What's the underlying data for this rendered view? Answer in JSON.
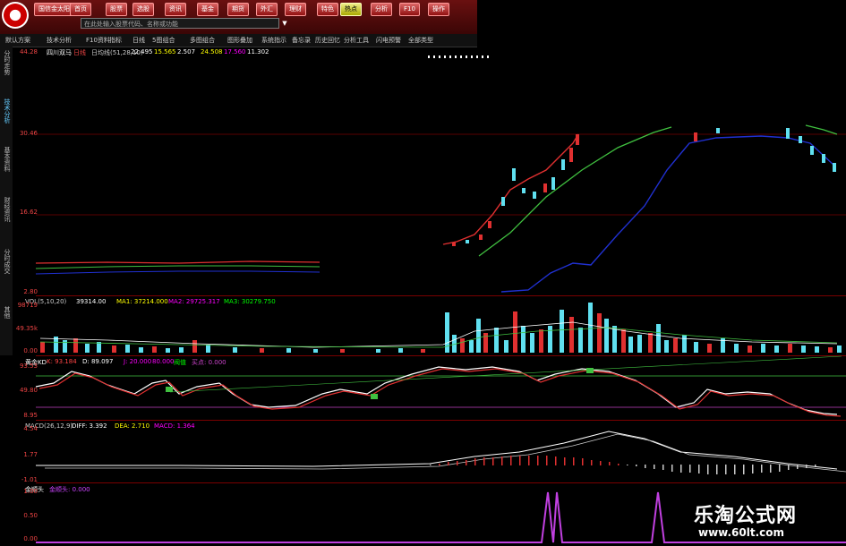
{
  "toolbar": {
    "buttons": [
      "国信金太阳",
      "首页",
      "股票",
      "选股",
      "资讯",
      "基金",
      "期货",
      "外汇",
      "理财",
      "特色",
      "热点",
      "分析",
      "F10",
      "操作"
    ],
    "command_placeholder": "在此处输入股票代码、名称或功能",
    "dropdown_arrow": "▼"
  },
  "menubar": {
    "items": [
      "默认方案",
      "技术分析",
      "F10资料",
      "指标",
      "日线",
      "5图组合",
      "多图组合",
      "图形叠加",
      "系统指示",
      "备忘录",
      "历史回忆",
      "分析工具",
      "闪电预警",
      "全部类型"
    ]
  },
  "sidetabs": {
    "items": [
      "分时走势",
      "技术分析",
      "基本资料",
      "财经资讯",
      "分时成交",
      "其他"
    ],
    "active": 1
  },
  "main_pane": {
    "stock_name": "四川双马",
    "period": "日线",
    "indicator": "日均线(51,28,10)",
    "values": [
      "22.495",
      "15.565",
      "2.507",
      "24.508",
      "17.560",
      "11.302"
    ],
    "y_labels": [
      "44.28",
      "30.46",
      "16.62",
      "2.80"
    ]
  },
  "volume_pane": {
    "header": "VOL(5,10,20)",
    "values": [
      "39314.00",
      "MA1: 37214.000",
      "MA2: 29725.317",
      "MA3: 30279.750"
    ],
    "y_labels": [
      "98719",
      "49.35k",
      "0.00"
    ]
  },
  "kdj_pane": {
    "header": "黄金KD",
    "values": [
      "K: 93.184",
      "D: 89.097",
      "J: 20.000",
      "80.000",
      "阀值",
      "买点: 0.000"
    ],
    "y_labels": [
      "93.53",
      "49.80",
      "8.95"
    ]
  },
  "macd_pane": {
    "header": "MACD(26,12,9)",
    "values": [
      "DIFF: 3.392",
      "DEA: 2.710",
      "MACD: 1.364"
    ],
    "y_labels": [
      "4.54",
      "1.77",
      "-1.01"
    ]
  },
  "signal_pane": {
    "header": "金顺头",
    "values": [
      "金顺头: 0.000"
    ],
    "y_labels": [
      "1.00",
      "0.50",
      "0.00"
    ]
  },
  "watermark": {
    "title": "乐淘公式网",
    "url": "www.60lt.com"
  },
  "colors": {
    "toolbar_bg": "#6a1010",
    "price_red": "#e03030",
    "ma_green": "#40c040",
    "ma_blue": "#2030d0",
    "cyan_bar": "#60e0f0",
    "kdj_k": "#ffffff",
    "signal_magenta": "#c040e0"
  }
}
